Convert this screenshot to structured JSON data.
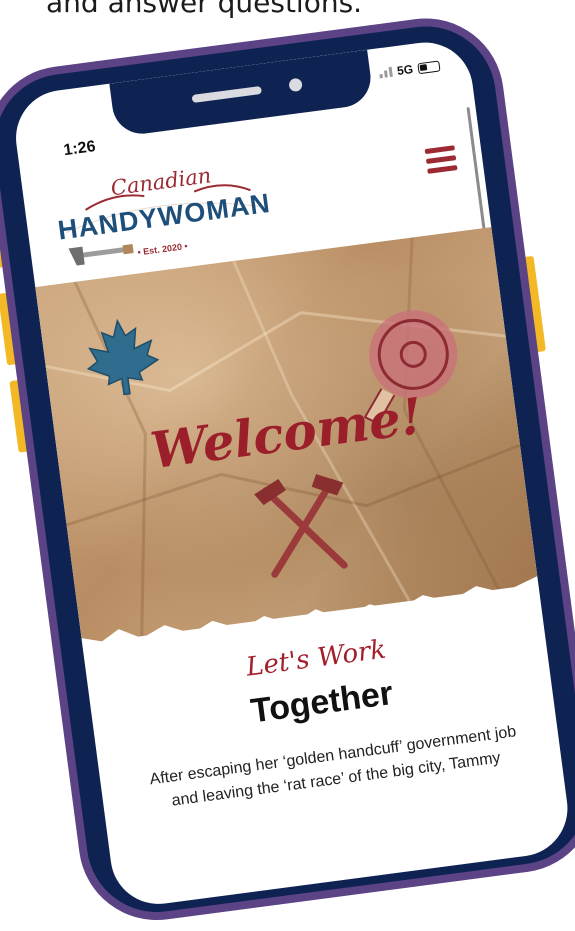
{
  "caption": "and answer questions.",
  "status_bar": {
    "time": "1:26",
    "network": "5G"
  },
  "logo": {
    "script": "Canadian",
    "wordmark": "HANDYWOMAN",
    "established": "• Est. 2020 •"
  },
  "hero": {
    "title": "Welcome!"
  },
  "intro": {
    "eyebrow": "Let's Work",
    "heading": "Together",
    "body": "After escaping her ‘golden handcuff’ government job and leaving the ‘rat race’ of the big city, Tammy"
  },
  "colors": {
    "brand_red": "#9b2a33",
    "brand_blue": "#1d4f7a",
    "frame_purple": "#5c4386",
    "frame_navy": "#0f2353",
    "side_buttons": "#f2b825"
  },
  "icons": [
    "hamburger-menu-icon",
    "maple-leaf-icon",
    "measuring-tape-icon",
    "crossed-hammers-icon",
    "battery-icon",
    "signal-icon"
  ]
}
